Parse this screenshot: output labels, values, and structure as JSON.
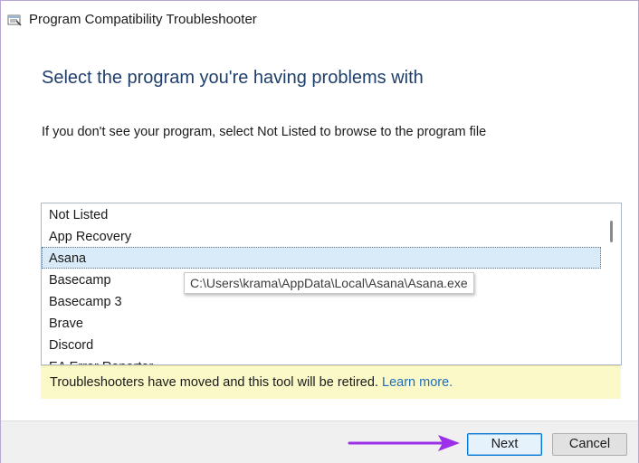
{
  "window": {
    "title": "Program Compatibility Troubleshooter",
    "icon": "troubleshooter-icon"
  },
  "main": {
    "heading": "Select the program you're having problems with",
    "instructions": "If you don't see your program, select Not Listed to browse to the program file"
  },
  "program_list": {
    "items": [
      {
        "label": "Not Listed",
        "selected": false
      },
      {
        "label": "App Recovery",
        "selected": false
      },
      {
        "label": "Asana",
        "selected": true
      },
      {
        "label": "Basecamp",
        "selected": false
      },
      {
        "label": "Basecamp 3",
        "selected": false
      },
      {
        "label": "Brave",
        "selected": false
      },
      {
        "label": "Discord",
        "selected": false
      },
      {
        "label": "EA Error Reporter",
        "selected": false
      }
    ],
    "tooltip": "C:\\Users\\krama\\AppData\\Local\\Asana\\Asana.exe"
  },
  "banner": {
    "text": "Troubleshooters have moved and this tool will be retired.",
    "link_label": "Learn more."
  },
  "footer": {
    "next_label": "Next",
    "cancel_label": "Cancel"
  },
  "annotation": {
    "arrow_color": "#9b30e8"
  },
  "colors": {
    "heading": "#1f3e6a",
    "selection": "#d9eaf8",
    "banner": "#fcf9c9",
    "link": "#1e6fb8"
  }
}
